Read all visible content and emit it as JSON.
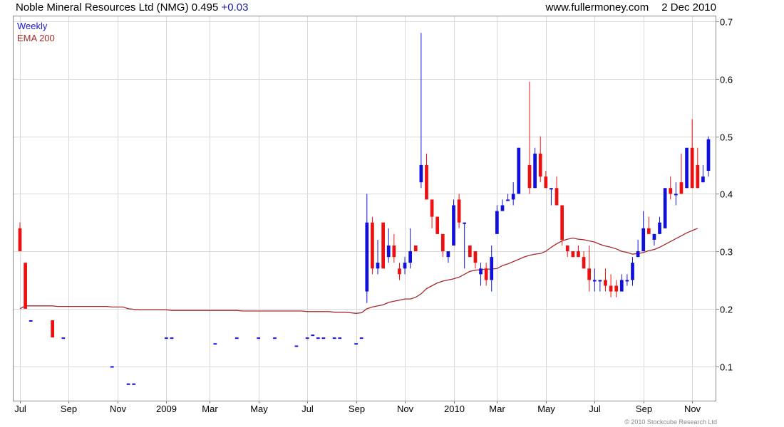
{
  "header": {
    "title": "Noble Mineral Resources Ltd (NMG)",
    "price": "0.495",
    "change": "+0.03",
    "site": "www.fullermoney.com",
    "date": "2 Dec 2010"
  },
  "legend": {
    "weekly": "Weekly",
    "ema": "EMA 200"
  },
  "copyright": "© 2010 Stockcube Research Ltd",
  "colors": {
    "up": "#1010dd",
    "down": "#ee1010",
    "ema": "#a52a2a",
    "grid": "#d9d9d9",
    "frame": "#888888"
  },
  "chart_data": {
    "type": "candlestick",
    "interval": "weekly",
    "ylim": [
      0.04,
      0.71
    ],
    "y_ticks": [
      0.1,
      0.2,
      0.3,
      0.4,
      0.5,
      0.6,
      0.7
    ],
    "x_tick_labels": [
      "Jul",
      "Sep",
      "Nov",
      "2009",
      "Mar",
      "May",
      "Jul",
      "Sep",
      "Nov",
      "2010",
      "Mar",
      "May",
      "Jul",
      "Sep",
      "Nov"
    ],
    "x_tick_index": [
      0,
      9,
      18,
      27,
      35,
      44,
      53,
      62,
      71,
      80,
      88,
      97,
      106,
      115,
      124
    ],
    "grid": true,
    "series_names": [
      "Weekly",
      "EMA 200"
    ],
    "candles": [
      [
        0.34,
        0.35,
        0.3,
        0.3
      ],
      [
        0.28,
        0.28,
        0.2,
        0.2
      ],
      [
        0.18,
        0.18,
        0.18,
        0.18
      ],
      null,
      null,
      null,
      [
        0.18,
        0.18,
        0.15,
        0.15
      ],
      null,
      [
        0.15,
        0.15,
        0.15,
        0.15
      ],
      null,
      null,
      null,
      null,
      null,
      null,
      null,
      null,
      [
        0.1,
        0.1,
        0.1,
        0.1
      ],
      null,
      null,
      [
        0.07,
        0.07,
        0.07,
        0.07
      ],
      [
        0.07,
        0.07,
        0.07,
        0.07
      ],
      null,
      null,
      null,
      null,
      null,
      [
        0.15,
        0.15,
        0.15,
        0.15
      ],
      [
        0.15,
        0.15,
        0.15,
        0.15
      ],
      null,
      null,
      null,
      null,
      null,
      null,
      null,
      [
        0.14,
        0.14,
        0.14,
        0.14
      ],
      null,
      null,
      null,
      [
        0.15,
        0.15,
        0.15,
        0.15
      ],
      null,
      null,
      null,
      [
        0.15,
        0.15,
        0.15,
        0.15
      ],
      null,
      null,
      [
        0.15,
        0.15,
        0.15,
        0.15
      ],
      null,
      null,
      null,
      [
        0.136,
        0.136,
        0.136,
        0.136
      ],
      null,
      [
        0.15,
        0.15,
        0.15,
        0.15
      ],
      [
        0.155,
        0.155,
        0.155,
        0.155
      ],
      [
        0.15,
        0.15,
        0.15,
        0.15
      ],
      [
        0.15,
        0.15,
        0.15,
        0.15
      ],
      null,
      [
        0.15,
        0.15,
        0.15,
        0.15
      ],
      [
        0.15,
        0.15,
        0.15,
        0.15
      ],
      null,
      null,
      [
        0.14,
        0.14,
        0.14,
        0.14
      ],
      [
        0.15,
        0.15,
        0.15,
        0.15
      ],
      [
        0.23,
        0.4,
        0.21,
        0.35
      ],
      [
        0.35,
        0.36,
        0.26,
        0.27
      ],
      [
        0.27,
        0.32,
        0.26,
        0.28
      ],
      [
        0.35,
        0.35,
        0.27,
        0.27
      ],
      [
        0.29,
        0.34,
        0.28,
        0.31
      ],
      [
        0.31,
        0.33,
        0.28,
        0.29
      ],
      [
        0.27,
        0.28,
        0.25,
        0.26
      ],
      [
        0.27,
        0.29,
        0.26,
        0.28
      ],
      [
        0.28,
        0.34,
        0.27,
        0.3
      ],
      [
        0.31,
        0.31,
        0.3,
        0.3
      ],
      [
        0.42,
        0.68,
        0.41,
        0.45
      ],
      [
        0.45,
        0.47,
        0.39,
        0.39
      ],
      [
        0.39,
        0.39,
        0.34,
        0.36
      ],
      [
        0.36,
        0.36,
        0.33,
        0.33
      ],
      [
        0.33,
        0.33,
        0.29,
        0.3
      ],
      [
        0.29,
        0.3,
        0.28,
        0.3
      ],
      [
        0.31,
        0.39,
        0.31,
        0.38
      ],
      [
        0.39,
        0.4,
        0.34,
        0.35
      ],
      [
        0.35,
        0.35,
        0.27,
        0.35
      ],
      [
        0.31,
        0.31,
        0.3,
        0.29
      ],
      [
        0.3,
        0.3,
        0.27,
        0.28
      ],
      [
        0.26,
        0.28,
        0.24,
        0.27
      ],
      [
        0.27,
        0.28,
        0.24,
        0.25
      ],
      [
        0.25,
        0.31,
        0.23,
        0.29
      ],
      [
        0.33,
        0.38,
        0.33,
        0.37
      ],
      [
        0.37,
        0.39,
        0.37,
        0.38
      ],
      [
        0.39,
        0.4,
        0.39,
        0.39
      ],
      [
        0.39,
        0.42,
        0.38,
        0.4
      ],
      [
        0.4,
        0.48,
        0.4,
        0.48
      ],
      null,
      [
        0.45,
        0.595,
        0.4,
        0.41
      ],
      [
        0.41,
        0.48,
        0.41,
        0.47
      ],
      [
        0.47,
        0.5,
        0.42,
        0.43
      ],
      [
        0.43,
        0.44,
        0.41,
        0.41
      ],
      [
        0.41,
        0.41,
        0.38,
        0.41
      ],
      [
        0.41,
        0.43,
        0.38,
        0.38
      ],
      [
        0.38,
        0.38,
        0.31,
        0.32
      ],
      [
        0.31,
        0.31,
        0.29,
        0.3
      ],
      [
        0.3,
        0.3,
        0.29,
        0.29
      ],
      [
        0.3,
        0.31,
        0.29,
        0.29
      ],
      [
        0.29,
        0.3,
        0.27,
        0.27
      ],
      [
        0.27,
        0.31,
        0.23,
        0.25
      ],
      [
        0.25,
        0.27,
        0.23,
        0.25
      ],
      [
        0.25,
        0.25,
        0.23,
        0.25
      ],
      [
        0.25,
        0.27,
        0.23,
        0.24
      ],
      [
        0.24,
        0.26,
        0.22,
        0.23
      ],
      [
        0.24,
        0.25,
        0.22,
        0.23
      ],
      [
        0.23,
        0.26,
        0.23,
        0.25
      ],
      [
        0.25,
        0.26,
        0.24,
        0.25
      ],
      [
        0.25,
        0.29,
        0.24,
        0.28
      ],
      [
        0.29,
        0.32,
        0.29,
        0.3
      ],
      [
        0.3,
        0.37,
        0.3,
        0.34
      ],
      [
        0.34,
        0.36,
        0.33,
        0.33
      ],
      [
        0.32,
        0.33,
        0.31,
        0.33
      ],
      [
        0.33,
        0.36,
        0.33,
        0.35
      ],
      [
        0.34,
        0.41,
        0.34,
        0.41
      ],
      [
        0.41,
        0.43,
        0.39,
        0.4
      ],
      [
        0.4,
        0.42,
        0.38,
        0.4
      ],
      [
        0.42,
        0.47,
        0.4,
        0.4
      ],
      [
        0.41,
        0.47,
        0.41,
        0.48
      ],
      [
        0.48,
        0.53,
        0.43,
        0.41
      ],
      [
        0.45,
        0.48,
        0.41,
        0.41
      ],
      [
        0.42,
        0.45,
        0.42,
        0.43
      ],
      [
        0.44,
        0.5,
        0.43,
        0.495
      ]
    ],
    "ema": [
      0.2,
      0.205,
      0.205,
      0.205,
      0.205,
      0.205,
      0.205,
      0.204,
      0.204,
      0.204,
      0.204,
      0.204,
      0.204,
      0.204,
      0.204,
      0.204,
      0.204,
      0.203,
      0.203,
      0.203,
      0.2,
      0.199,
      0.198,
      0.198,
      0.198,
      0.198,
      0.198,
      0.198,
      0.197,
      0.197,
      0.197,
      0.197,
      0.197,
      0.197,
      0.197,
      0.197,
      0.197,
      0.197,
      0.197,
      0.197,
      0.197,
      0.196,
      0.196,
      0.196,
      0.196,
      0.196,
      0.196,
      0.196,
      0.196,
      0.196,
      0.196,
      0.196,
      0.196,
      0.195,
      0.195,
      0.195,
      0.195,
      0.195,
      0.194,
      0.194,
      0.194,
      0.193,
      0.192,
      0.193,
      0.2,
      0.203,
      0.205,
      0.207,
      0.211,
      0.213,
      0.215,
      0.217,
      0.217,
      0.22,
      0.226,
      0.235,
      0.24,
      0.245,
      0.248,
      0.25,
      0.252,
      0.255,
      0.26,
      0.265,
      0.267,
      0.268,
      0.269,
      0.269,
      0.27,
      0.275,
      0.278,
      0.282,
      0.286,
      0.29,
      0.293,
      0.295,
      0.296,
      0.3,
      0.307,
      0.313,
      0.318,
      0.321,
      0.323,
      0.321,
      0.32,
      0.318,
      0.316,
      0.312,
      0.309,
      0.307,
      0.304,
      0.3,
      0.298,
      0.295,
      0.296,
      0.298,
      0.301,
      0.303,
      0.307,
      0.312,
      0.317,
      0.322,
      0.327,
      0.332,
      0.336,
      0.34
    ]
  }
}
